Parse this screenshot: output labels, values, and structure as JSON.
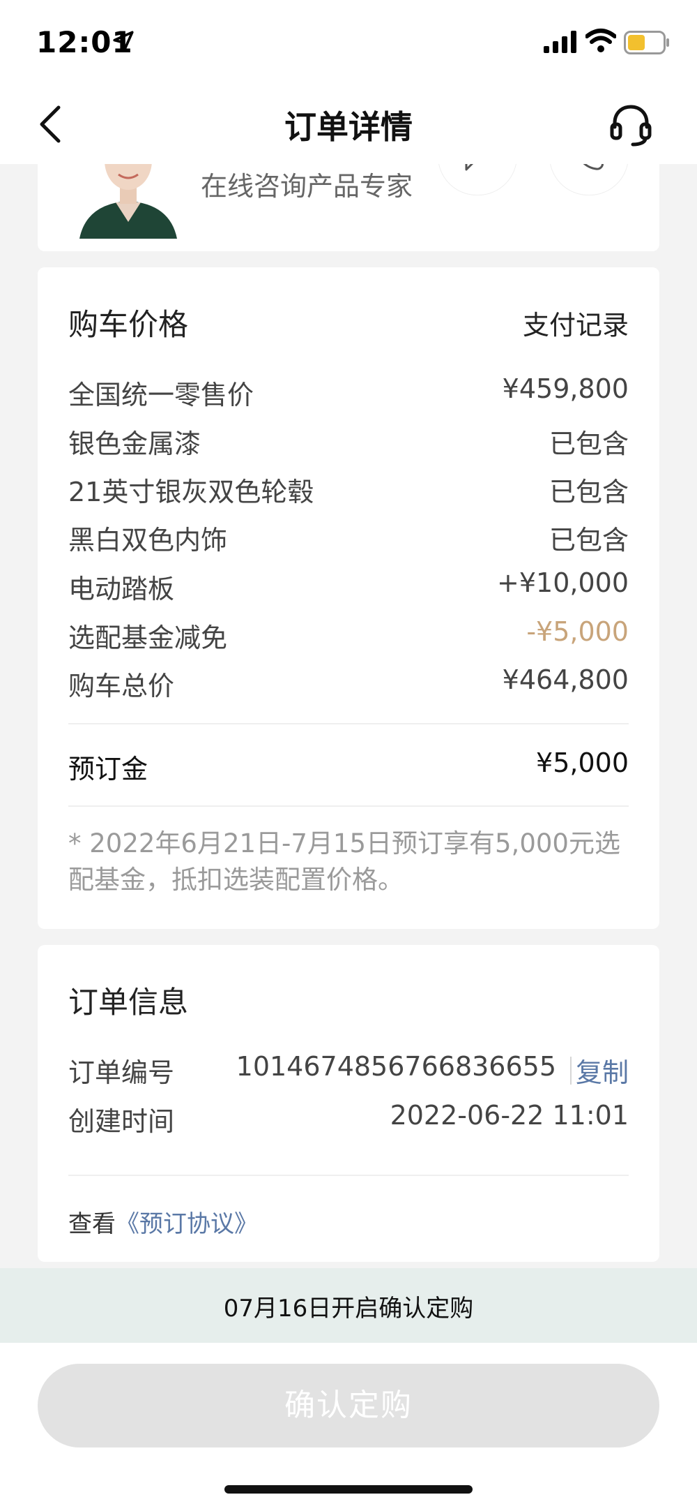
{
  "status_bar": {
    "time": "12:01"
  },
  "nav": {
    "title": "订单详情"
  },
  "advisor": {
    "label": "在线咨询产品专家"
  },
  "price": {
    "title": "购车价格",
    "payment_link": "支付记录",
    "rows": [
      {
        "label": "全国统一零售价",
        "value": "¥459,800"
      },
      {
        "label": "银色金属漆",
        "value": "已包含"
      },
      {
        "label": "21英寸银灰双色轮毂",
        "value": "已包含"
      },
      {
        "label": "黑白双色内饰",
        "value": "已包含"
      },
      {
        "label": "电动踏板",
        "value": "+¥10,000"
      },
      {
        "label": "选配基金减免",
        "value": "-¥5,000"
      },
      {
        "label": "购车总价",
        "value": "¥464,800"
      }
    ],
    "deposit_label": "预订金",
    "deposit_value": "¥5,000",
    "note": "* 2022年6月21日-7月15日预订享有5,000元选配基金，抵扣选装配置价格。"
  },
  "order": {
    "title": "订单信息",
    "number_label": "订单编号",
    "number_value": "1014674856766836655",
    "copy_label": "复制",
    "created_label": "创建时间",
    "created_value": "2022-06-22 11:01",
    "view_prefix": "查看",
    "agreement_link": "《预订协议》"
  },
  "banner": {
    "text": "07月16日开启确认定购"
  },
  "bottom": {
    "confirm_label": "确认定购"
  },
  "colors": {
    "discount": "#c8a47a",
    "link": "#5a78a6",
    "banner_bg": "#e6eeec",
    "button_disabled": "#e2e2e2"
  }
}
